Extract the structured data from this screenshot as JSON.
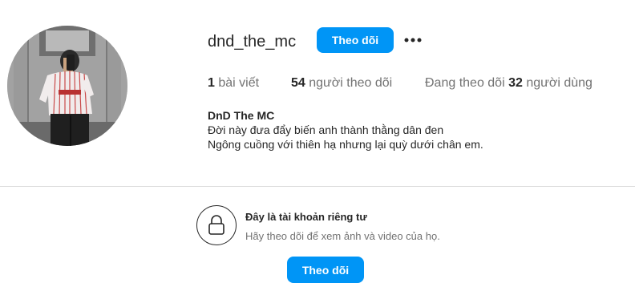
{
  "profile": {
    "username": "dnd_the_mc",
    "follow_label": "Theo dõi",
    "more_icon": "more-horizontal-icon",
    "stats": {
      "posts_count": "1",
      "posts_label": " bài viết",
      "followers_count": "54",
      "followers_label": " người theo dõi",
      "following_prefix": "Đang theo dõi ",
      "following_count": "32",
      "following_label": " người dùng"
    },
    "bio": {
      "name": "DnD The MC",
      "lines": [
        "Đời này đưa đẩy biến anh thành thằng dân đen",
        "Ngông cuồng với thiên hạ nhưng lại quỳ dưới chân em."
      ]
    }
  },
  "private_account": {
    "icon": "lock-icon",
    "title": "Đây là tài khoản riêng tư",
    "subtitle": "Hãy theo dõi để xem ảnh và video của họ.",
    "follow_label": "Theo dõi"
  },
  "colors": {
    "accent": "#0095f6",
    "text_primary": "#262626",
    "text_secondary": "#737373",
    "divider": "#dbdbdb"
  }
}
